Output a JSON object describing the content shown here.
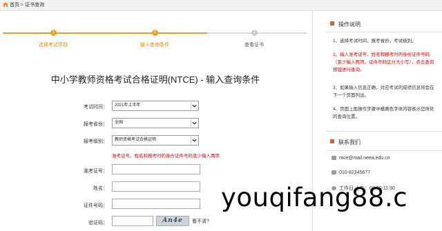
{
  "breadcrumb": {
    "home": "首页",
    "separator": ">",
    "current": "证书查询"
  },
  "steps": [
    {
      "number": "1",
      "label": "选择考试项目",
      "state": "done"
    },
    {
      "number": "2",
      "label": "输入查询条件",
      "state": "active"
    },
    {
      "number": "3",
      "label": "查看证书",
      "state": "pending"
    }
  ],
  "page_title": "中小学教师资格考试合格证明(NTCE) - 输入查询条件",
  "form": {
    "exam_time": {
      "label": "考试时间：",
      "value": "2021年上半年"
    },
    "province": {
      "label": "报考省份：",
      "value": "全国"
    },
    "level": {
      "label": "报考级别：",
      "value": "教师资格考试合格证明"
    },
    "warning": "准考证号、姓名和报考时的身份证件号码至少输入两项",
    "ticket": {
      "label": "准考证号：",
      "value": ""
    },
    "name": {
      "label": "姓名：",
      "value": ""
    },
    "id_number": {
      "label": "证件号码：",
      "value": ""
    },
    "captcha": {
      "label": "验证码：",
      "value": "",
      "image_text": "An4e",
      "unclear": "看不清?"
    }
  },
  "sidebar": {
    "instructions_title": "操作说明",
    "notes": [
      {
        "text": "1、选择考试时间，报考省份，考试级别。",
        "style": "normal"
      },
      {
        "text": "2、输入准考证号、姓名和报考时的身份证件号码（至少输入两项，证件号码区分大小写），点击查询按钮进行查询。",
        "style": "red"
      },
      {
        "text": "3、如果输入信息正确，对应考试的成绩信息将会在下一个页面列出。",
        "style": "normal"
      },
      {
        "text": "4、页面上面操作步骤中橘黄色字体内容表示您所处的查询位置。",
        "style": "normal"
      }
    ],
    "contact_title": "联系我们",
    "email": "ntce@mail.neea.edu.cn",
    "phone": "010-82345677",
    "hours": "工作日 上午：08:30-11:30"
  },
  "watermark": "youqifang88.c"
}
